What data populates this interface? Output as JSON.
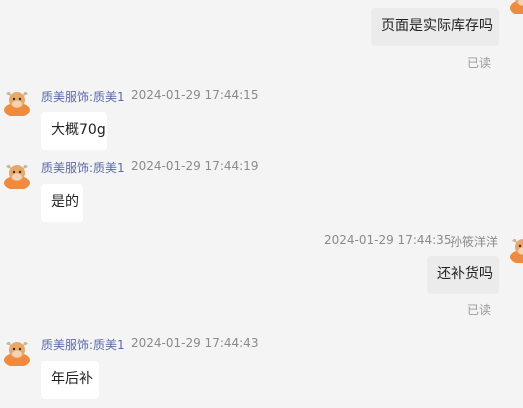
{
  "messages": [
    {
      "direction": "out",
      "text": "页面是实际库存吗",
      "status": "已读"
    },
    {
      "direction": "in",
      "sender": "质美服饰:质美1",
      "time": "2024-01-29 17:44:15",
      "text": "大概70g"
    },
    {
      "direction": "in",
      "sender": "质美服饰:质美1",
      "time": "2024-01-29 17:44:19",
      "text": "是的"
    },
    {
      "direction": "out",
      "sender": "孙筱洋洋",
      "time": "2024-01-29 17:44:35",
      "text": "还补货吗",
      "status": "已读"
    },
    {
      "direction": "in",
      "sender": "质美服饰:质美1",
      "time": "2024-01-29 17:44:43",
      "text": "年后补"
    }
  ],
  "icons": {
    "seller_avatar": "cartoon-cow-avatar-icon",
    "buyer_avatar": "cartoon-cow-avatar-icon"
  },
  "colors": {
    "background": "#f4f4f4",
    "incoming_bubble": "#ffffff",
    "outgoing_bubble": "#ebebeb",
    "sender_name": "#5a6aa8",
    "avatar_orange": "#f08a3c"
  }
}
